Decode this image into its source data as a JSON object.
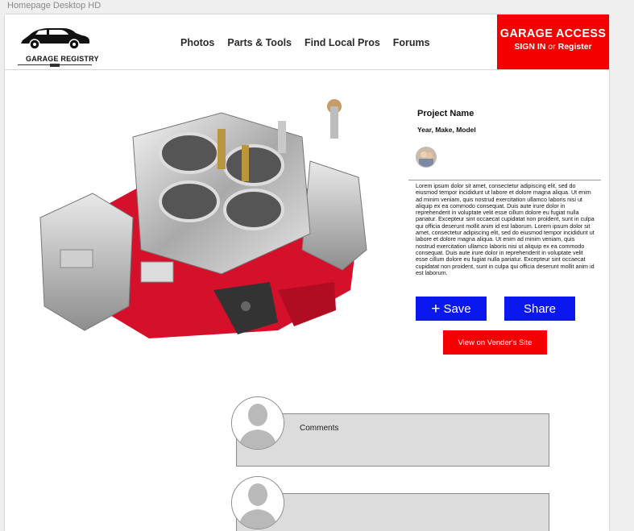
{
  "artboard_label": "Homepage Desktop HD",
  "header": {
    "logo_text": "GARAGE REGISTRY",
    "nav": [
      "Photos",
      "Parts & Tools",
      "Find Local Pros",
      "Forums"
    ],
    "garage_access": {
      "title": "GARAGE ACCESS",
      "sign_in": "SIGN IN",
      "or": "or",
      "register": "Register"
    }
  },
  "project": {
    "name": "Project Name",
    "year_make_model": "Year, Make, Model",
    "description": "Lorem ipsum dolor sit amet, consectetur adipiscing elit, sed do eiusmod tempor incididunt ut labore et dolore magna aliqua. Ut enim ad minim veniam, quis nostrud exercitation ullamco laboris nisi ut aliquip ex ea commodo consequat. Duis aute irure dolor in reprehenderit in voluptate velit esse cillum dolore eu fugiat nulla pariatur. Excepteur sint occaecat cupidatat non proident, sunt in culpa qui officia deserunt mollit anim id est laborum.  Lorem ipsum dolor sit amet, consectetur adipiscing elit, sed do eiusmod tempor incididunt ut labore et dolore magna aliqua. Ut enim ad minim veniam, quis nostrud exercitation ullamco laboris nisi ut aliquip ex ea commodo consequat. Duis aute irure dolor in reprehenderit in voluptate velit esse cillum dolore eu fugiat nulla pariatur. Excepteur sint occaecat cupidatat non proident, sunt in culpa qui officia deserunt mollit anim id est laborum."
  },
  "actions": {
    "save_label": "Save",
    "share_label": "Share",
    "vendor_label": "View on Vender's Site"
  },
  "comments": {
    "label": "Comments"
  },
  "colors": {
    "brand_red": "#f40000",
    "button_blue": "#0a17ef"
  }
}
